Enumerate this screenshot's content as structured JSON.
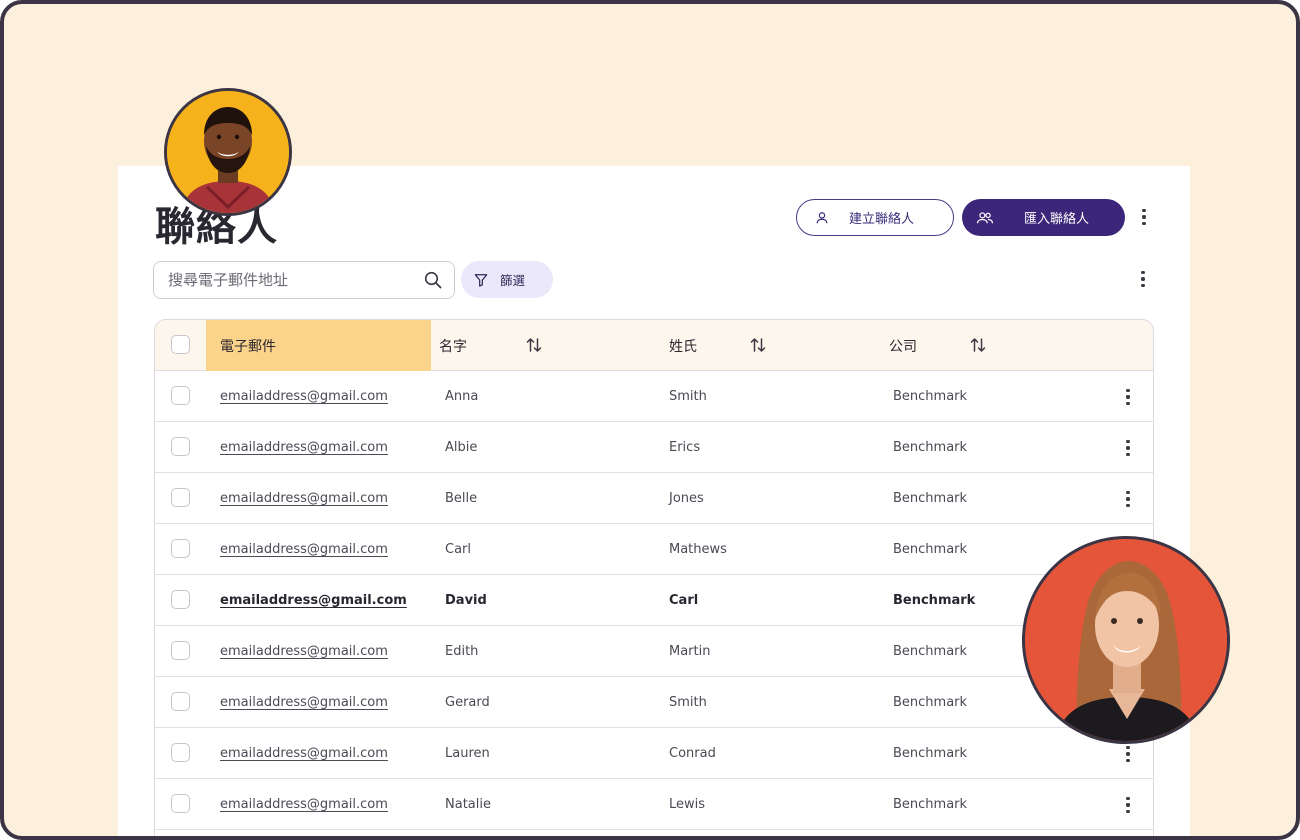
{
  "page": {
    "title": "聯絡人"
  },
  "actions": {
    "create_contact": "建立聯絡人",
    "import_contacts": "匯入聯絡人"
  },
  "search": {
    "placeholder": "搜尋電子郵件地址"
  },
  "filter": {
    "label": "篩選"
  },
  "table": {
    "headers": {
      "email": "電子郵件",
      "first_name": "名字",
      "last_name": "姓氏",
      "company": "公司"
    },
    "rows": [
      {
        "email": "emailaddress@gmail.com",
        "first": "Anna",
        "last": "Smith",
        "company": "Benchmark"
      },
      {
        "email": "emailaddress@gmail.com",
        "first": "Albie",
        "last": "Erics",
        "company": "Benchmark"
      },
      {
        "email": "emailaddress@gmail.com",
        "first": "Belle",
        "last": "Jones",
        "company": "Benchmark"
      },
      {
        "email": "emailaddress@gmail.com",
        "first": "Carl",
        "last": "Mathews",
        "company": "Benchmark"
      },
      {
        "email": "emailaddress@gmail.com",
        "first": "David",
        "last": "Carl",
        "company": "Benchmark"
      },
      {
        "email": "emailaddress@gmail.com",
        "first": "Edith",
        "last": "Martin",
        "company": "Benchmark"
      },
      {
        "email": "emailaddress@gmail.com",
        "first": "Gerard",
        "last": "Smith",
        "company": "Benchmark"
      },
      {
        "email": "emailaddress@gmail.com",
        "first": "Lauren",
        "last": "Conrad",
        "company": "Benchmark"
      },
      {
        "email": "emailaddress@gmail.com",
        "first": "Natalie",
        "last": "Lewis",
        "company": "Benchmark"
      }
    ]
  },
  "colors": {
    "background": "#fcefdc",
    "accent": "#3b2679",
    "header_highlight": "#fcd38a",
    "filter_chip": "#ebe8fb"
  },
  "icons": [
    "person-icon",
    "group-icon",
    "more-vertical-icon",
    "search-icon",
    "filter-icon",
    "sort-icon"
  ]
}
